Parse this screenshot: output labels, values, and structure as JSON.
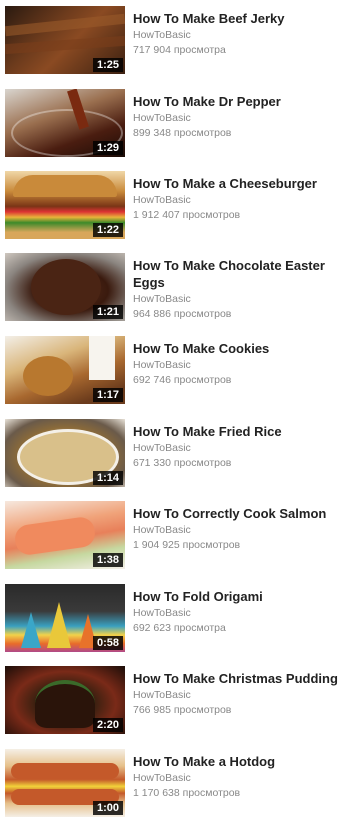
{
  "videos": [
    {
      "title": "How To Make Beef Jerky",
      "channel": "HowToBasic",
      "views": "717 904 просмотра",
      "duration": "1:25",
      "thumb": "beef-jerky-thumbnail"
    },
    {
      "title": "How To Make Dr Pepper",
      "channel": "HowToBasic",
      "views": "899 348 просмотров",
      "duration": "1:29",
      "thumb": "dr-pepper-thumbnail"
    },
    {
      "title": "How To Make a Cheeseburger",
      "channel": "HowToBasic",
      "views": "1 912 407 просмотров",
      "duration": "1:22",
      "thumb": "cheeseburger-thumbnail"
    },
    {
      "title": "How To Make Chocolate Easter Eggs",
      "channel": "HowToBasic",
      "views": "964 886 просмотров",
      "duration": "1:21",
      "thumb": "easter-eggs-thumbnail"
    },
    {
      "title": "How To Make Cookies",
      "channel": "HowToBasic",
      "views": "692 746 просмотров",
      "duration": "1:17",
      "thumb": "cookies-thumbnail"
    },
    {
      "title": "How To Make Fried Rice",
      "channel": "HowToBasic",
      "views": "671 330 просмотров",
      "duration": "1:14",
      "thumb": "fried-rice-thumbnail"
    },
    {
      "title": "How To Correctly Cook Salmon",
      "channel": "HowToBasic",
      "views": "1 904 925 просмотров",
      "duration": "1:38",
      "thumb": "salmon-thumbnail"
    },
    {
      "title": "How To Fold Origami",
      "channel": "HowToBasic",
      "views": "692 623 просмотра",
      "duration": "0:58",
      "thumb": "origami-thumbnail"
    },
    {
      "title": "How To Make Christmas Pudding",
      "channel": "HowToBasic",
      "views": "766 985 просмотров",
      "duration": "2:20",
      "thumb": "christmas-pudding-thumbnail"
    },
    {
      "title": "How To Make a Hotdog",
      "channel": "HowToBasic",
      "views": "1 170 638 просмотров",
      "duration": "1:00",
      "thumb": "hotdog-thumbnail"
    }
  ]
}
